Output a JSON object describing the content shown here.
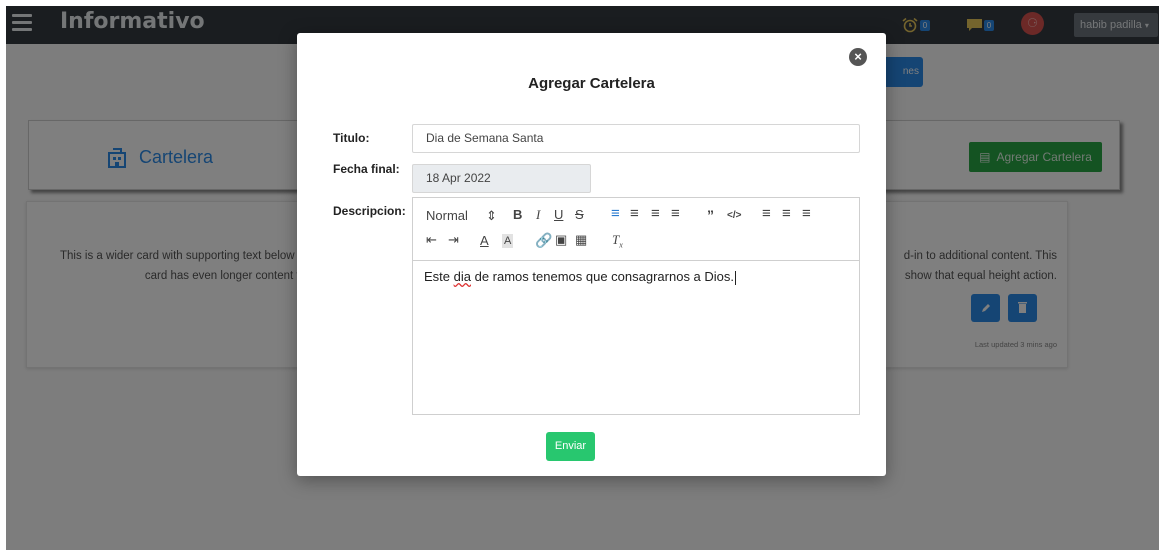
{
  "nav": {
    "brand": "Informativo",
    "alarm_count": "0",
    "messages_count": "0",
    "user": "habib padilla"
  },
  "background": {
    "partial_button": "nes",
    "header_title": "Cartelera",
    "add_button": "Agregar Cartelera",
    "card_left_lines": [
      "This is a wider card with supporting text below as",
      "card has even longer content th"
    ],
    "card_right_lines": [
      "d-in to additional content. This",
      "show that equal height action."
    ],
    "updated_text": "Last updated 3 mins ago"
  },
  "modal": {
    "title": "Agregar Cartelera",
    "titulo_label": "Titulo:",
    "titulo_value": "Dia de Semana Santa",
    "fecha_label": "Fecha final:",
    "fecha_value": "18 Apr 2022",
    "descripcion_label": "Descripcion:",
    "format_select": "Normal",
    "content_before": "Este ",
    "content_misspelled": "dia",
    "content_after": " de ramos tenemos que consagrarnos a Dios.",
    "submit_label": "Enviar"
  },
  "colors": {
    "navbar": "#343a40",
    "primary": "#2a8be8",
    "success": "#28a745",
    "submit": "#28c76f",
    "danger": "#d9534f"
  }
}
